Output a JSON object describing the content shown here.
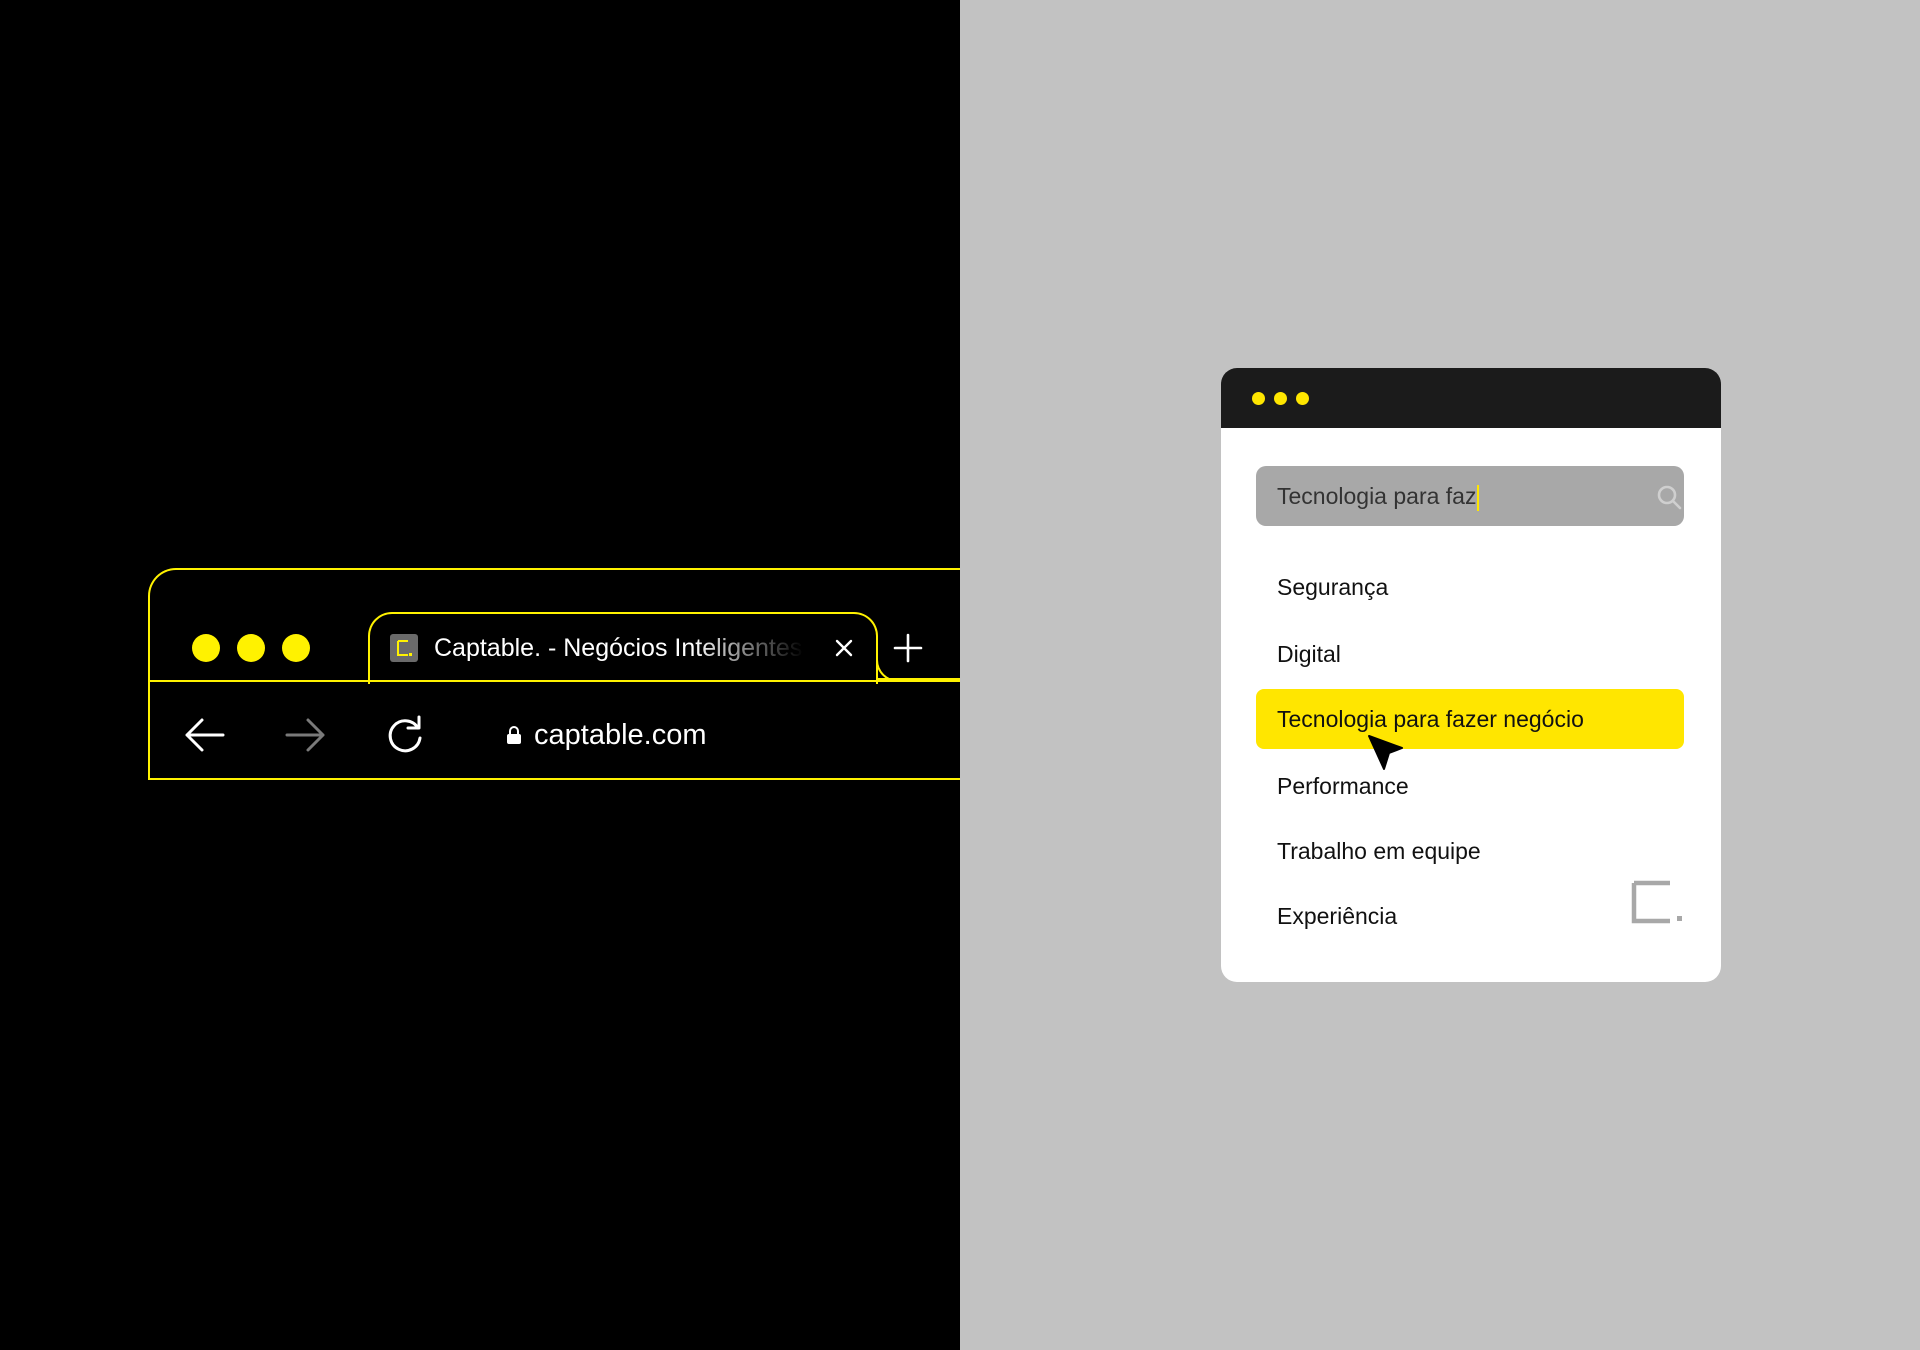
{
  "colors": {
    "accent": "#fff200",
    "highlight": "#ffe600",
    "left_bg": "#000000",
    "right_bg": "#c2c2c2"
  },
  "browser": {
    "tab": {
      "title": "Captable. - Negócios Inteligentes",
      "favicon": "captable-logo-icon"
    },
    "icons": {
      "close": "close-icon",
      "new_tab": "plus-icon",
      "back": "arrow-left-icon",
      "forward": "arrow-right-icon",
      "reload": "reload-icon",
      "lock": "lock-icon"
    },
    "url": "captable.com"
  },
  "widget": {
    "search": {
      "value": "Tecnologia para faz",
      "icon": "search-icon"
    },
    "suggestions": [
      {
        "label": "Segurança",
        "active": false
      },
      {
        "label": "Digital",
        "active": false
      },
      {
        "label": "Tecnologia para fazer negócio",
        "active": true
      },
      {
        "label": "Performance",
        "active": false
      },
      {
        "label": "Trabalho em equipe",
        "active": false
      },
      {
        "label": "Experiência",
        "active": false
      }
    ],
    "pointer": "mouse-pointer-icon",
    "brand": "captable-logo-mark"
  }
}
